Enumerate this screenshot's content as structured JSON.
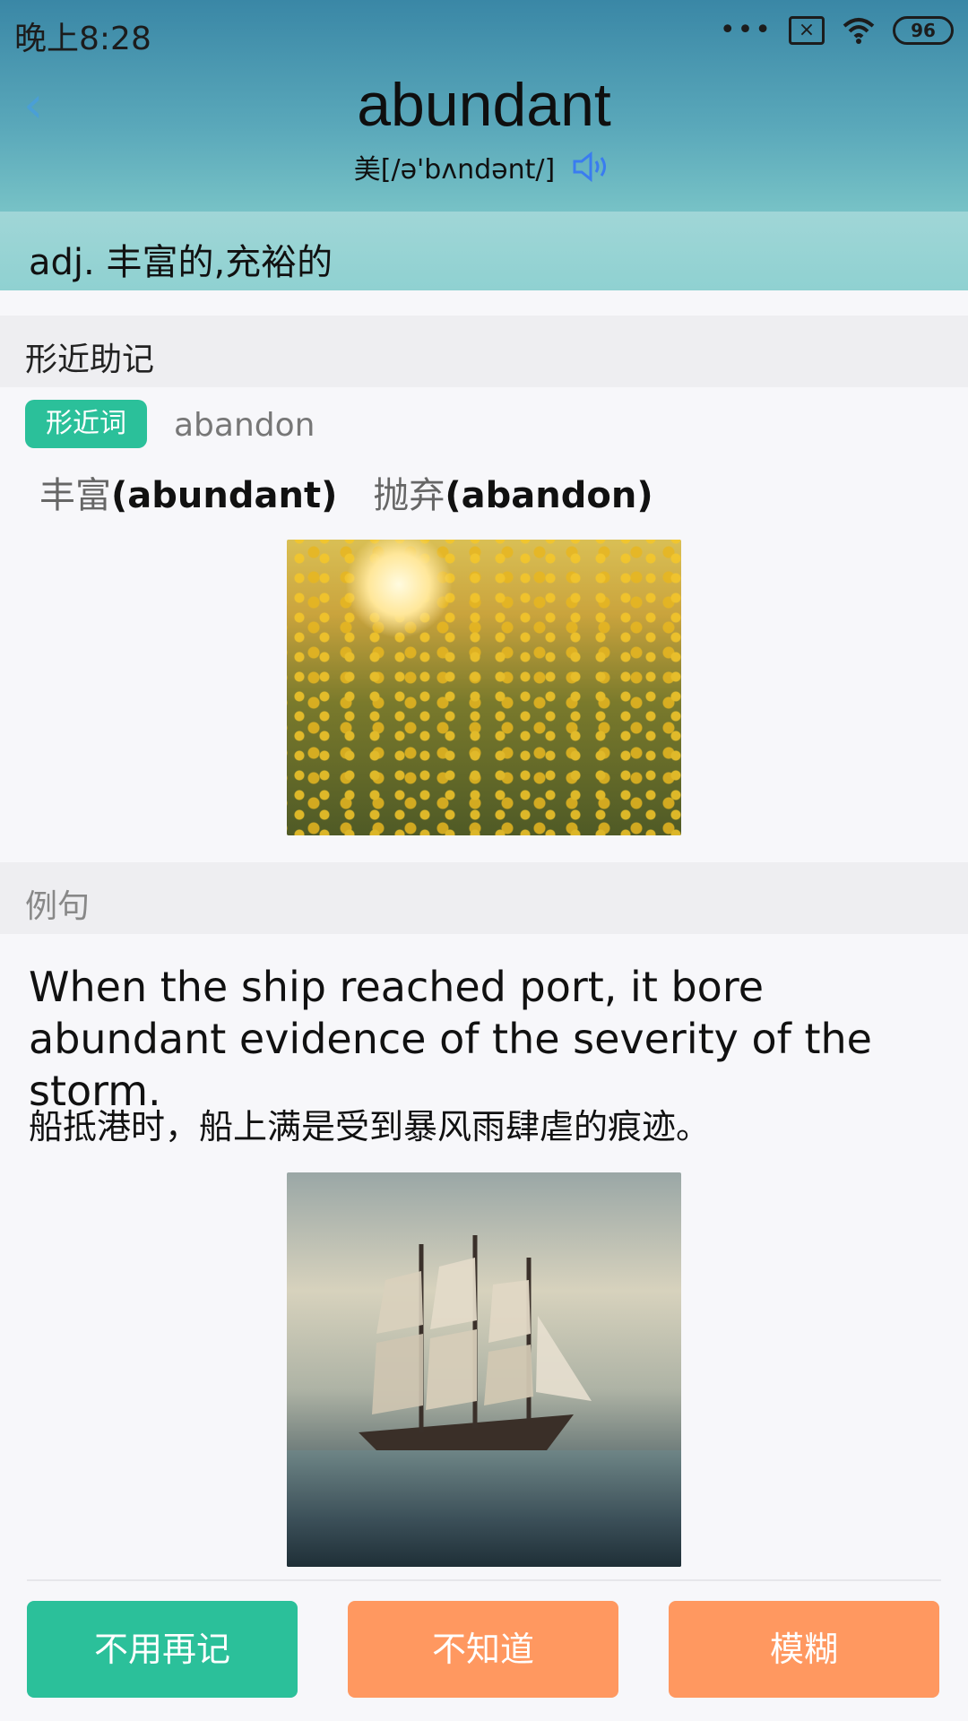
{
  "status_bar": {
    "time": "晚上8:28",
    "battery": "96"
  },
  "header": {
    "back_icon": "chevron-left-icon",
    "word": "abundant",
    "phonetic": "美[/ə'bʌndənt/]",
    "speaker_icon": "speaker-icon",
    "definition": "adj. 丰富的,充裕的"
  },
  "mnemonic": {
    "section_title": "形近助记",
    "tag": "形近词",
    "similar_word": "abandon",
    "compare_left_zh": "丰富",
    "compare_left_en": "(abundant)",
    "compare_right_zh": "抛弃",
    "compare_right_en": "(abandon)"
  },
  "example": {
    "section_title": "例句",
    "sentence_en": "When the ship reached port, it bore abundant evidence of the severity of the storm.",
    "sentence_zh": "船抵港时，船上满是受到暴风雨肆虐的痕迹。"
  },
  "actions": {
    "no_need": "不用再记",
    "dont_know": "不知道",
    "vague": "模糊"
  },
  "colors": {
    "accent_green": "#2bc09a",
    "accent_orange": "#ff9860",
    "link_blue": "#4a9fd6"
  }
}
